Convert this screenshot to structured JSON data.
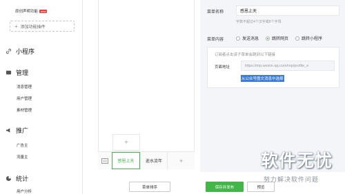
{
  "sidebar": {
    "top_item": "原创声明功能",
    "top_item_badge": "new",
    "add_plugin": "添加功能插件",
    "sections": [
      {
        "title": "小程序",
        "items": []
      },
      {
        "title": "管理",
        "items": [
          "消息管理",
          "用户管理",
          "素材管理"
        ]
      },
      {
        "title": "推广",
        "items": [
          "广告主",
          "流量主"
        ]
      },
      {
        "title": "统计",
        "items": [
          "用户分析"
        ]
      }
    ]
  },
  "phone": {
    "menu_items": [
      "感恩上天",
      "逝水流年"
    ],
    "add_symbol": "+"
  },
  "panel": {
    "name_label": "菜单名称",
    "name_value": "感恩上天",
    "name_hint": "字数不超过4个汉字或8个字母",
    "content_label": "菜单内容",
    "options": [
      "发送消息",
      "跳转网页",
      "跳转小程序"
    ],
    "selected_option": "跳转网页",
    "sub_tip": "订阅者点击该子菜单会跳到以下链接",
    "url_label": "页面地址",
    "url_value": "https://mp.weixin.qq.com/mp/profile_e",
    "pick_link": "从公众号图文消息中选择"
  },
  "buttons": {
    "sort": "菜单排序",
    "save": "保存并发布",
    "preview": "预览"
  },
  "watermark": {
    "title": "软件无忧",
    "subtitle": "努力解决软件问题"
  },
  "colors": {
    "accent": "#44b549",
    "badge": "#e64340",
    "link_highlight": "#3a7bd5"
  }
}
